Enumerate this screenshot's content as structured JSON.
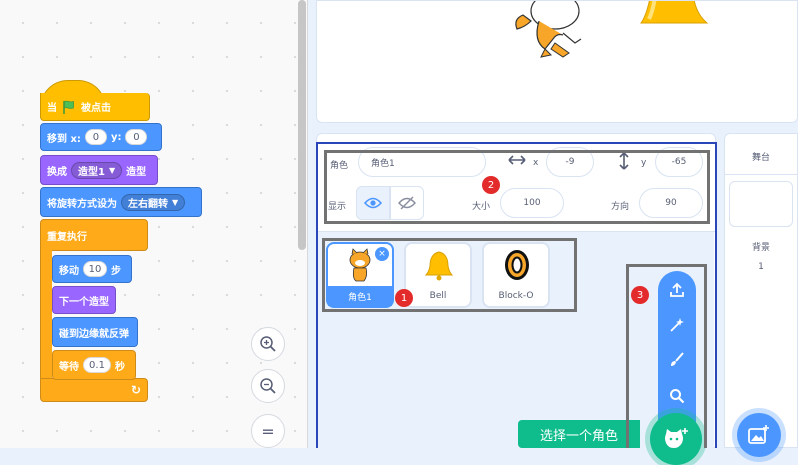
{
  "code_area": {
    "blocks": {
      "when_flag_prefix": "当",
      "when_flag_suffix": "被点击",
      "goto_label": "移到 x:",
      "goto_x": "0",
      "goto_y_label": "y:",
      "goto_y": "0",
      "switch_costume_prefix": "换成",
      "switch_costume_value": "造型1",
      "switch_costume_suffix": "造型",
      "rotation_label": "将旋转方式设为",
      "rotation_value": "左右翻转",
      "forever_label": "重复执行",
      "move_label": "移动",
      "move_steps": "10",
      "move_suffix": "步",
      "next_costume_label": "下一个造型",
      "bounce_label": "碰到边缘就反弹",
      "wait_label": "等待",
      "wait_value": "0.1",
      "wait_suffix": "秒"
    },
    "zoom_in_icon": "zoom-in",
    "zoom_out_icon": "zoom-out",
    "zoom_reset_icon": "="
  },
  "sprite_info": {
    "sprite_label": "角色",
    "sprite_name": "角色1",
    "x_label": "x",
    "x_value": "-9",
    "y_label": "y",
    "y_value": "-65",
    "show_label": "显示",
    "size_label": "大小",
    "size_value": "100",
    "direction_label": "方向",
    "direction_value": "90"
  },
  "sprites": [
    {
      "name": "角色1",
      "selected": true,
      "delete_label": "×"
    },
    {
      "name": "Bell",
      "selected": false
    },
    {
      "name": "Block-O",
      "selected": false
    }
  ],
  "sprite_menu": {
    "icons": [
      "upload-icon",
      "surprise-icon",
      "paint-icon",
      "search-icon"
    ],
    "tooltip": "选择一个角色"
  },
  "stage_pane": {
    "title": "舞台",
    "backdrops_label": "背景",
    "backdrops_count": "1"
  },
  "annotations": {
    "badge1": "1",
    "badge2": "2",
    "badge3": "3",
    "box_color": "#727272",
    "frame_color": "#2a46b8",
    "badge_color": "#e32b2b"
  },
  "colors": {
    "motion": "#4c97ff",
    "looks": "#9966ff",
    "events": "#ffbf00",
    "control": "#ffab19",
    "sprite_action": "#0fbd8c"
  }
}
